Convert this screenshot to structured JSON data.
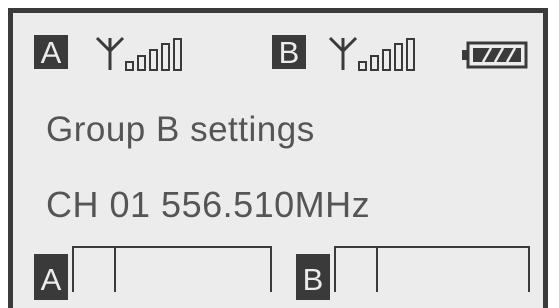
{
  "status_bar": {
    "channel_a": {
      "label": "A",
      "signal_bars_lit": 0,
      "signal_bars_total": 5,
      "antenna_icon": "antenna-icon"
    },
    "channel_b": {
      "label": "B",
      "signal_bars_lit": 0,
      "signal_bars_total": 5,
      "antenna_icon": "antenna-icon"
    },
    "battery": {
      "icon": "battery-icon",
      "level_fraction": 0.75
    }
  },
  "display": {
    "line1": "Group B settings",
    "line2": "CH 01 556.510MHz"
  },
  "meters": {
    "a": {
      "label": "A",
      "level_fraction": 0.0
    },
    "b": {
      "label": "B",
      "level_fraction": 0.0
    }
  },
  "colors": {
    "lcd_background": "#ececec",
    "segment_dark": "#3a3a3a",
    "text": "#555555"
  }
}
